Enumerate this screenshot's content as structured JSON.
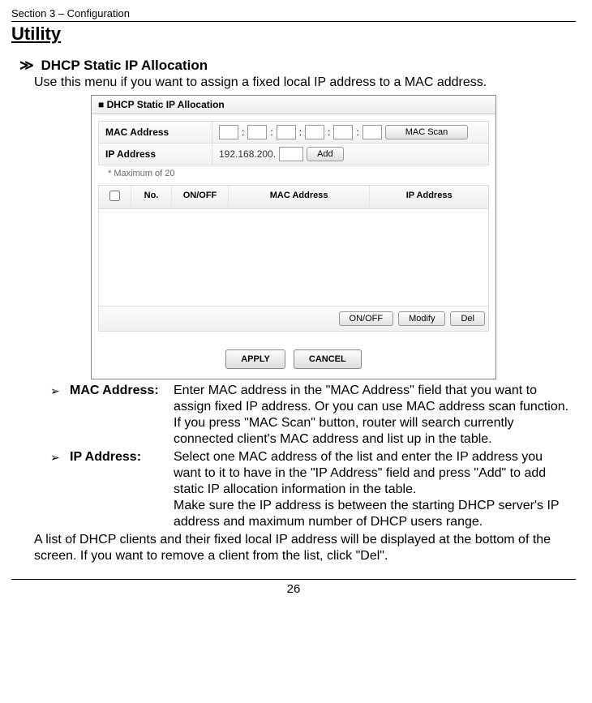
{
  "header": {
    "section_label": "Section 3 – Configuration",
    "utility": "Utility"
  },
  "topic": {
    "marker": "≫",
    "title": "DHCP Static IP Allocation",
    "intro": "Use this menu if you want to assign a fixed local IP address to a MAC address."
  },
  "screenshot": {
    "title_icon": "■",
    "title": "DHCP Static IP Allocation",
    "mac_label": "MAC Address",
    "ip_label": "IP Address",
    "mac_scan": "MAC Scan",
    "ip_prefix": "192.168.200.",
    "add": "Add",
    "max_note": "* Maximum of 20",
    "th_chk": "",
    "th_no": "No.",
    "th_onoff": "ON/OFF",
    "th_mac": "MAC Address",
    "th_ip": "IP Address",
    "btn_onoff": "ON/OFF",
    "btn_modify": "Modify",
    "btn_del": "Del",
    "apply": "APPLY",
    "cancel": "CANCEL"
  },
  "defs": {
    "bullet": "➢",
    "mac": {
      "term": "MAC Address:",
      "p1": "Enter MAC address in the \"MAC Address\" field that you want to assign fixed IP address. Or you can use MAC address scan function.",
      "p2": "If you press \"MAC Scan\" button, router will search currently connected client's MAC address and list up in the table."
    },
    "ip": {
      "term": "IP Address:",
      "p1": "Select one MAC address of the list and enter the IP address you want to it to have in the \"IP Address\" field and press \"Add\" to add static IP allocation information in the table.",
      "p2": "Make sure the IP address is between the starting DHCP server's IP address and maximum number of DHCP users range."
    }
  },
  "closing": "A list of DHCP clients and their fixed local IP address will be displayed at the bottom of the screen. If you want to remove a client from the list, click \"Del\".",
  "page_number": "26"
}
